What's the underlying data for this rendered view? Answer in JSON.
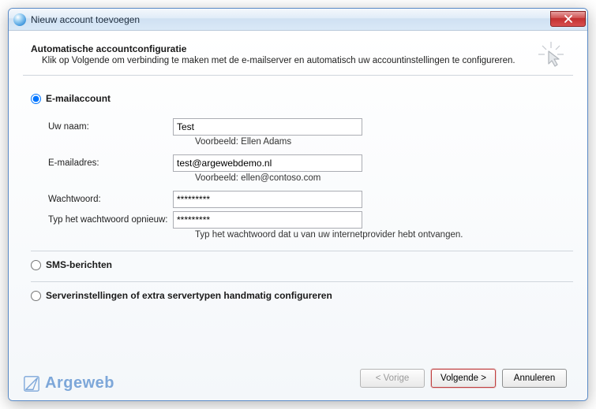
{
  "window": {
    "title": "Nieuw account toevoegen"
  },
  "header": {
    "title": "Automatische accountconfiguratie",
    "subtitle": "Klik op Volgende om verbinding te maken met de e-mailserver en automatisch uw accountinstellingen te configureren."
  },
  "options": {
    "email": "E-mailaccount",
    "sms": "SMS-berichten",
    "manual": "Serverinstellingen of extra servertypen handmatig configureren"
  },
  "fields": {
    "name_label": "Uw naam:",
    "name_value": "Test",
    "name_hint": "Voorbeeld: Ellen Adams",
    "email_label": "E-mailadres:",
    "email_value": "test@argewebdemo.nl",
    "email_hint": "Voorbeeld: ellen@contoso.com",
    "password_label": "Wachtwoord:",
    "password_value": "*********",
    "password2_label": "Typ het wachtwoord opnieuw:",
    "password2_value": "*********",
    "password_hint": "Typ het wachtwoord dat u van uw internetprovider hebt ontvangen."
  },
  "footer": {
    "brand": "Argeweb",
    "back": "< Vorige",
    "next": "Volgende >",
    "cancel": "Annuleren"
  }
}
